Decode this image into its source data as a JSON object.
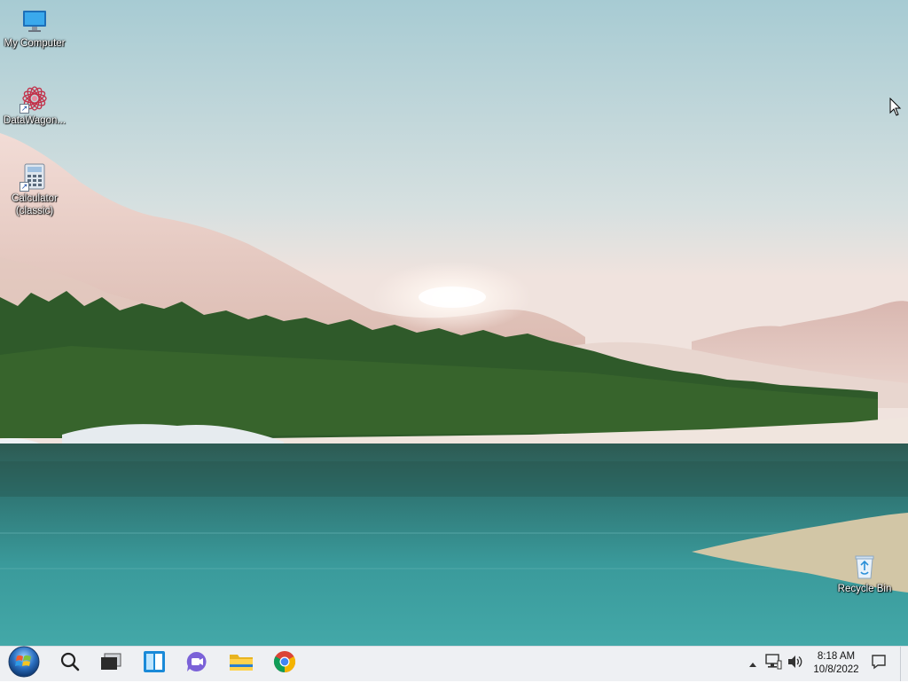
{
  "desktop": {
    "icons": [
      {
        "label": "My Computer",
        "icon": "computer-icon"
      },
      {
        "label": "DataWagon...",
        "icon": "datawagon-icon"
      },
      {
        "label": "Calculator (classic)",
        "icon": "calculator-icon"
      },
      {
        "label": "Recycle Bin",
        "icon": "recycle-bin-icon"
      }
    ]
  },
  "taskbar": {
    "pinned": [
      {
        "name": "start",
        "icon": "windows-orb-icon"
      },
      {
        "name": "search",
        "icon": "search-icon"
      },
      {
        "name": "task-view",
        "icon": "task-view-icon"
      },
      {
        "name": "widgets",
        "icon": "widgets-icon"
      },
      {
        "name": "chat",
        "icon": "teams-chat-icon"
      },
      {
        "name": "file-explorer",
        "icon": "folder-icon"
      },
      {
        "name": "chrome",
        "icon": "chrome-icon"
      }
    ],
    "tray": {
      "time": "8:18 AM",
      "date": "10/8/2022",
      "icons": [
        "chevron-up-icon",
        "network-icon",
        "volume-icon",
        "notification-icon"
      ]
    }
  },
  "colors": {
    "taskbar_bg": "#eef0f3",
    "sky_top": "#a9ccd4",
    "water": "#3e9a9c",
    "forest": "#2f5a2a"
  }
}
